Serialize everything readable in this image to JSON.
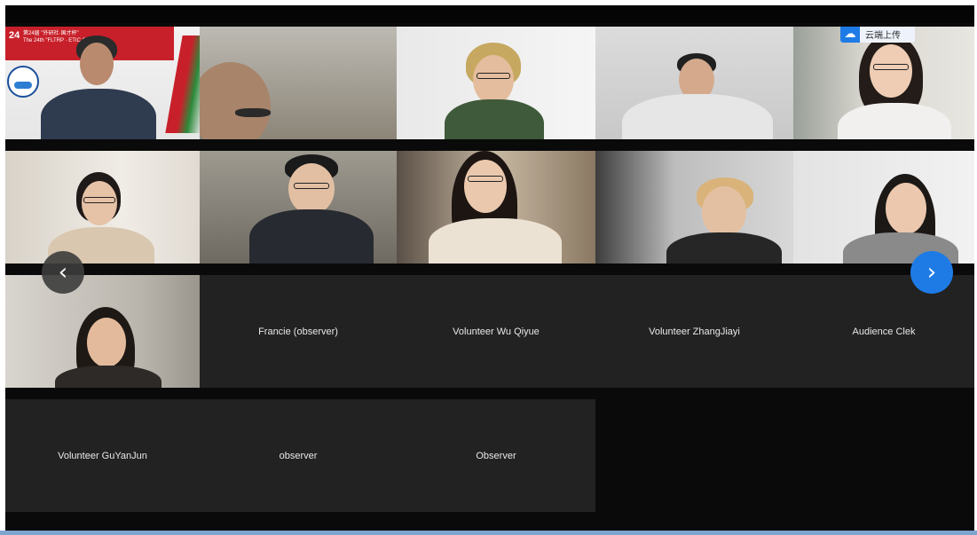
{
  "window": {
    "title": ""
  },
  "upload_badge": {
    "label": "云端上传",
    "icon": "cloud-app-icon"
  },
  "banner": {
    "line1": "第24届 \"外研社·国才杯\"",
    "line2": "The 24th \"FLTRP · ETIC Cup\"",
    "badge": "24"
  },
  "navigation": {
    "prev_label": "‹",
    "next_label": "›",
    "prev_icon": "chevron-left-icon",
    "next_icon": "chevron-right-icon",
    "next_color": "#1e7be6"
  },
  "participants": {
    "video_row1": [
      "",
      "",
      "",
      "",
      ""
    ],
    "video_row2": [
      "",
      "",
      "",
      "",
      ""
    ],
    "video_row3": [
      ""
    ],
    "name_row3": [
      "Francie (observer)",
      "Volunteer Wu Qiyue",
      "Volunteer ZhangJiayi",
      "Audience Clek"
    ],
    "name_row4": [
      "Volunteer GuYanJun",
      "observer",
      "Observer"
    ]
  }
}
